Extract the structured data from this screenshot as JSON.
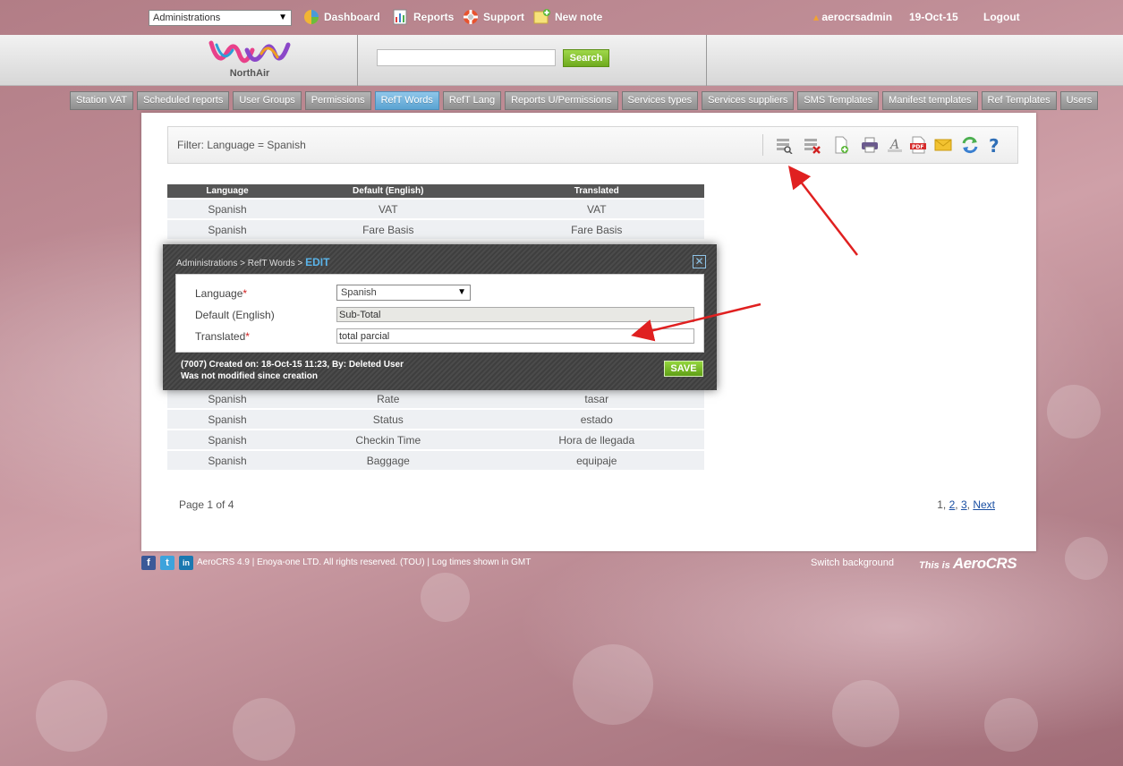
{
  "topbar": {
    "module_select": "Administrations",
    "nav": [
      {
        "label": "Dashboard",
        "icon": "dashboard-icon"
      },
      {
        "label": "Reports",
        "icon": "reports-icon"
      },
      {
        "label": "Support",
        "icon": "support-icon"
      },
      {
        "label": "New note",
        "icon": "new-note-icon"
      }
    ],
    "username": "aerocrsadmin",
    "date": "19-Oct-15",
    "logout": "Logout"
  },
  "header": {
    "logo_text": "NorthAir",
    "search_value": "",
    "search_button": "Search"
  },
  "tabs": [
    {
      "label": "Station VAT",
      "active": false
    },
    {
      "label": "Scheduled reports",
      "active": false
    },
    {
      "label": "User Groups",
      "active": false
    },
    {
      "label": "Permissions",
      "active": false
    },
    {
      "label": "RefT Words",
      "active": true
    },
    {
      "label": "RefT Lang",
      "active": false
    },
    {
      "label": "Reports U/Permissions",
      "active": false
    },
    {
      "label": "Services types",
      "active": false
    },
    {
      "label": "Services suppliers",
      "active": false
    },
    {
      "label": "SMS Templates",
      "active": false
    },
    {
      "label": "Manifest templates",
      "active": false
    },
    {
      "label": "Ref Templates",
      "active": false
    },
    {
      "label": "Users",
      "active": false
    }
  ],
  "filter": {
    "text": "Filter: Language = Spanish",
    "tools": [
      "filter-icon",
      "clear-filter-icon",
      "add-record-icon",
      "print-icon",
      "font-icon",
      "pdf-icon",
      "email-icon",
      "refresh-icon",
      "help-icon"
    ]
  },
  "table": {
    "columns": [
      "Language",
      "Default (English)",
      "Translated"
    ],
    "rows": [
      [
        "Spanish",
        "VAT",
        "VAT"
      ],
      [
        "Spanish",
        "Fare Basis",
        "Fare Basis"
      ],
      [
        "Spanish",
        "Rate",
        "tasar"
      ],
      [
        "Spanish",
        "Status",
        "estado"
      ],
      [
        "Spanish",
        "Checkin Time",
        "Hora de llegada"
      ],
      [
        "Spanish",
        "Baggage",
        "equipaje"
      ]
    ]
  },
  "pagination": {
    "info": "Page 1 of 4",
    "current": "1",
    "links": [
      "2",
      "3"
    ],
    "next": "Next"
  },
  "footer": {
    "social": [
      {
        "letter": "f",
        "icon": "facebook-icon",
        "color": "#3b5998"
      },
      {
        "letter": "t",
        "icon": "twitter-icon",
        "color": "#3da3dc"
      },
      {
        "letter": "in",
        "icon": "linkedin-icon",
        "color": "#1b78b0"
      }
    ],
    "text": "AeroCRS 4.9  |  Enoya-one LTD. All rights reserved. (TOU)  |  Log times shown in GMT",
    "switch_background": "Switch background",
    "this_is": "This is",
    "brand": "AeroCRS"
  },
  "modal": {
    "breadcrumb": "Administrations > RefT Words > ",
    "mode": "EDIT",
    "fields": {
      "language_label": "Language",
      "language_value": "Spanish",
      "default_label": "Default (English)",
      "default_value": "Sub-Total",
      "translated_label": "Translated",
      "translated_value": "total parcial"
    },
    "required_mark": "*",
    "meta_created": "(7007) Created on: 18-Oct-15 11:23, By: Deleted User",
    "meta_modified": "Was not modified since creation",
    "save": "SAVE"
  },
  "colors": {
    "accent_green": "#6faa1e",
    "active_tab": "#5aa3d2",
    "annotation_arrow": "#e02020"
  }
}
